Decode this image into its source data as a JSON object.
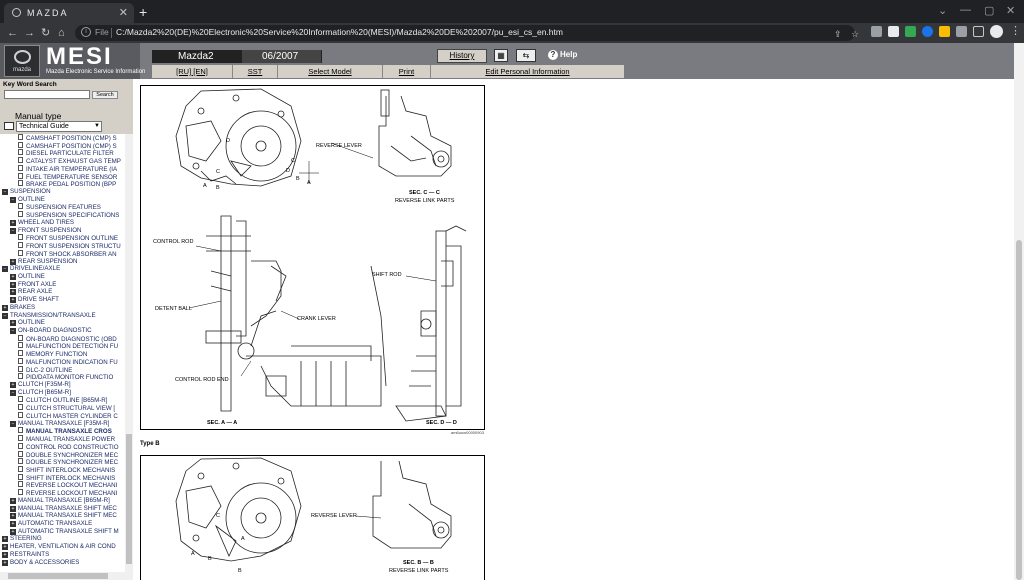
{
  "browser": {
    "tab_title": "MAZDA",
    "file_label": "File",
    "url": "C:/Mazda2%20(DE)%20Electronic%20Service%20Information%20(MESI)/Mazda2%20DE%202007/pu_esi_cs_en.htm"
  },
  "header": {
    "logo_wordmark": "mazda",
    "app_name": "MESI",
    "app_subtitle": "Mazda Electronic Service Information",
    "model": "Mazda2",
    "date": "06/2007",
    "history_label": "History",
    "help_label": "Help"
  },
  "menu": {
    "language": "[RU] [EN]",
    "sst": "SST",
    "select_model": "Select Model",
    "print": "Print",
    "edit_personal": "Edit Personal Information"
  },
  "sidebar": {
    "keyword_label": "Key Word Search",
    "search_button": "Search",
    "manual_type_label": "Manual type",
    "manual_type_value": "Technical Guide"
  },
  "tree": [
    {
      "label": "CAMSHAFT POSITION (CMP) S",
      "indent": 3,
      "kind": "doc"
    },
    {
      "label": "CAMSHAFT POSITION (CMP) S",
      "indent": 3,
      "kind": "doc"
    },
    {
      "label": "DIESEL PARTICULATE FILTER",
      "indent": 3,
      "kind": "doc"
    },
    {
      "label": "CATALYST EXHAUST GAS TEMP",
      "indent": 3,
      "kind": "doc"
    },
    {
      "label": "INTAKE AIR TEMPERATURE (IA",
      "indent": 3,
      "kind": "doc"
    },
    {
      "label": "FUEL TEMPERATURE SENSOR",
      "indent": 3,
      "kind": "doc"
    },
    {
      "label": "BRAKE PEDAL POSITION (BPP",
      "indent": 3,
      "kind": "doc"
    },
    {
      "label": "SUSPENSION",
      "indent": 1,
      "kind": "minus"
    },
    {
      "label": "OUTLINE",
      "indent": 2,
      "kind": "minus"
    },
    {
      "label": "SUSPENSION FEATURES",
      "indent": 3,
      "kind": "doc"
    },
    {
      "label": "SUSPENSION SPECIFICATIONS",
      "indent": 3,
      "kind": "doc"
    },
    {
      "label": "WHEEL AND TIRES",
      "indent": 2,
      "kind": "plus"
    },
    {
      "label": "FRONT SUSPENSION",
      "indent": 2,
      "kind": "minus"
    },
    {
      "label": "FRONT SUSPENSION OUTLINE",
      "indent": 3,
      "kind": "doc"
    },
    {
      "label": "FRONT SUSPENSION STRUCTU",
      "indent": 3,
      "kind": "doc"
    },
    {
      "label": "FRONT SHOCK ABSORBER AN",
      "indent": 3,
      "kind": "doc"
    },
    {
      "label": "REAR SUSPENSION",
      "indent": 2,
      "kind": "plus"
    },
    {
      "label": "DRIVELINE/AXLE",
      "indent": 1,
      "kind": "minus"
    },
    {
      "label": "OUTLINE",
      "indent": 2,
      "kind": "plus"
    },
    {
      "label": "FRONT AXLE",
      "indent": 2,
      "kind": "plus"
    },
    {
      "label": "REAR AXLE",
      "indent": 2,
      "kind": "plus"
    },
    {
      "label": "DRIVE SHAFT",
      "indent": 2,
      "kind": "plus"
    },
    {
      "label": "BRAKES",
      "indent": 1,
      "kind": "plus"
    },
    {
      "label": "TRANSMISSION/TRANSAXLE",
      "indent": 1,
      "kind": "minus"
    },
    {
      "label": "OUTLINE",
      "indent": 2,
      "kind": "plus"
    },
    {
      "label": "ON-BOARD DIAGNOSTIC",
      "indent": 2,
      "kind": "minus"
    },
    {
      "label": "ON-BOARD DIAGNOSTIC (OBD",
      "indent": 3,
      "kind": "doc"
    },
    {
      "label": "MALFUNCTION DETECTION FU",
      "indent": 3,
      "kind": "doc"
    },
    {
      "label": "MEMORY FUNCTION",
      "indent": 3,
      "kind": "doc"
    },
    {
      "label": "MALFUNCTION INDICATION FU",
      "indent": 3,
      "kind": "doc"
    },
    {
      "label": "DLC-2 OUTLINE",
      "indent": 3,
      "kind": "doc"
    },
    {
      "label": "PID/DATA MONITOR FUNCTIO",
      "indent": 3,
      "kind": "doc"
    },
    {
      "label": "CLUTCH [F35M-R]",
      "indent": 2,
      "kind": "plus"
    },
    {
      "label": "CLUTCH [B65M-R]",
      "indent": 2,
      "kind": "minus"
    },
    {
      "label": "CLUTCH OUTLINE [B65M-R]",
      "indent": 3,
      "kind": "doc"
    },
    {
      "label": "CLUTCH STRUCTURAL VIEW [",
      "indent": 3,
      "kind": "doc"
    },
    {
      "label": "CLUTCH MASTER CYLINDER C",
      "indent": 3,
      "kind": "doc"
    },
    {
      "label": "MANUAL TRANSAXLE [F35M-R]",
      "indent": 2,
      "kind": "minus"
    },
    {
      "label": "MANUAL TRANSAXLE CROS",
      "indent": 3,
      "kind": "doc",
      "selected": true
    },
    {
      "label": "MANUAL TRANSAXLE POWER",
      "indent": 3,
      "kind": "doc"
    },
    {
      "label": "CONTROL ROD CONSTRUCTIO",
      "indent": 3,
      "kind": "doc"
    },
    {
      "label": "DOUBLE SYNCHRONIZER MEC",
      "indent": 3,
      "kind": "doc"
    },
    {
      "label": "DOUBLE SYNCHRONIZER MEC",
      "indent": 3,
      "kind": "doc"
    },
    {
      "label": "SHIFT INTERLOCK MECHANIS",
      "indent": 3,
      "kind": "doc"
    },
    {
      "label": "SHIFT INTERLOCK MECHANIS",
      "indent": 3,
      "kind": "doc"
    },
    {
      "label": "REVERSE LOCKOUT MECHANI",
      "indent": 3,
      "kind": "doc"
    },
    {
      "label": "REVERSE LOCKOUT MECHANI",
      "indent": 3,
      "kind": "doc"
    },
    {
      "label": "MANUAL TRANSAXLE [B65M-R]",
      "indent": 2,
      "kind": "plus"
    },
    {
      "label": "MANUAL TRANSAXLE SHIFT MEC",
      "indent": 2,
      "kind": "plus"
    },
    {
      "label": "MANUAL TRANSAXLE SHIFT MEC",
      "indent": 2,
      "kind": "plus"
    },
    {
      "label": "AUTOMATIC TRANSAXLE",
      "indent": 2,
      "kind": "plus"
    },
    {
      "label": "AUTOMATIC TRANSAXLE SHIFT M",
      "indent": 2,
      "kind": "plus"
    },
    {
      "label": "STEERING",
      "indent": 1,
      "kind": "plus"
    },
    {
      "label": "HEATER, VENTILATION & AIR COND",
      "indent": 1,
      "kind": "plus"
    },
    {
      "label": "RESTRAINTS",
      "indent": 1,
      "kind": "plus"
    },
    {
      "label": "BODY & ACCESSORIES",
      "indent": 1,
      "kind": "plus"
    }
  ],
  "figure1": {
    "label_reverse_lever": "REVERSE LEVER",
    "label_sec_cc": "SEC. C — C",
    "label_reverse_link_parts": "REVERSE LINK PARTS",
    "label_control_rod": "CONTROL ROD",
    "label_shift_rod": "SHIFT ROD",
    "label_detent_ball": "DETENT BALL",
    "label_crank_lever": "CRANK LEVER",
    "label_control_rod_end": "CONTROL ROD END",
    "label_sec_aa": "SEC. A — A",
    "label_sec_dd": "SEC. D — D",
    "letters": [
      "D",
      "C",
      "A",
      "B",
      "C",
      "D",
      "B",
      "A"
    ],
    "fig_code": "am6uuw00000903"
  },
  "type_b_label": "Type B",
  "figure2": {
    "label_reverse_lever": "REVERSE LEVER",
    "label_sec_bb": "SEC. B — B",
    "label_reverse_link_parts": "REVERSE LINK PARTS",
    "letters": [
      "C",
      "A",
      "B",
      "B",
      "A"
    ]
  }
}
